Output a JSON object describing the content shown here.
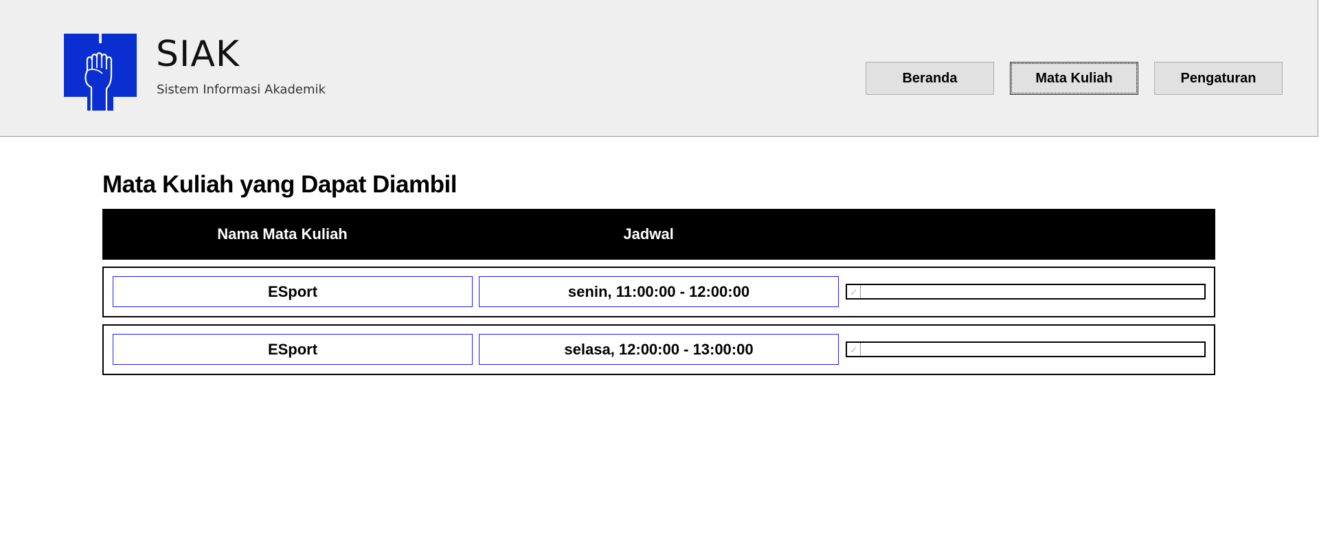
{
  "brand": {
    "title": "SIAK",
    "subtitle": "Sistem Informasi Akademik",
    "logo_icon": "raised-fist-book-logo",
    "logo_color": "#0a2fd0"
  },
  "nav": {
    "items": [
      {
        "label": "Beranda",
        "active": false
      },
      {
        "label": "Mata Kuliah",
        "active": true
      },
      {
        "label": "Pengaturan",
        "active": false
      }
    ]
  },
  "main": {
    "title": "Mata Kuliah yang Dapat Diambil",
    "columns": [
      "Nama Mata Kuliah",
      "Jadwal",
      ""
    ],
    "rows": [
      {
        "name": "ESport",
        "schedule": "senin, 11:00:00 - 12:00:00",
        "checked": true
      },
      {
        "name": "ESport",
        "schedule": "selasa, 12:00:00 - 13:00:00",
        "checked": true
      }
    ]
  },
  "colors": {
    "header_bg": "#efefef",
    "table_header_bg": "#000000",
    "cell_border": "#1a1aff"
  }
}
